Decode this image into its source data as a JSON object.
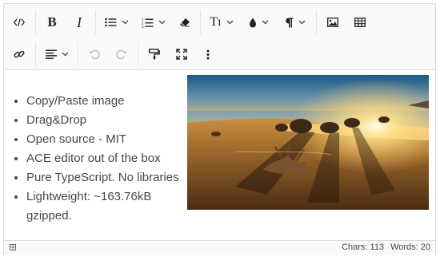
{
  "toolbar": {
    "bold_label": "B",
    "italic_label": "I",
    "font_label": "Tı",
    "source_icon": "code-icon",
    "brush_icon": "paint-format-icon"
  },
  "content": {
    "items": [
      "Copy/Paste image",
      "Drag&Drop",
      "Open source - MIT",
      "ACE editor out of the box",
      "Pure TypeScript. No libraries",
      "Lightweight: ~163.76kB gzipped."
    ]
  },
  "status": {
    "chars": "Chars: 113",
    "words": "Words: 20"
  }
}
